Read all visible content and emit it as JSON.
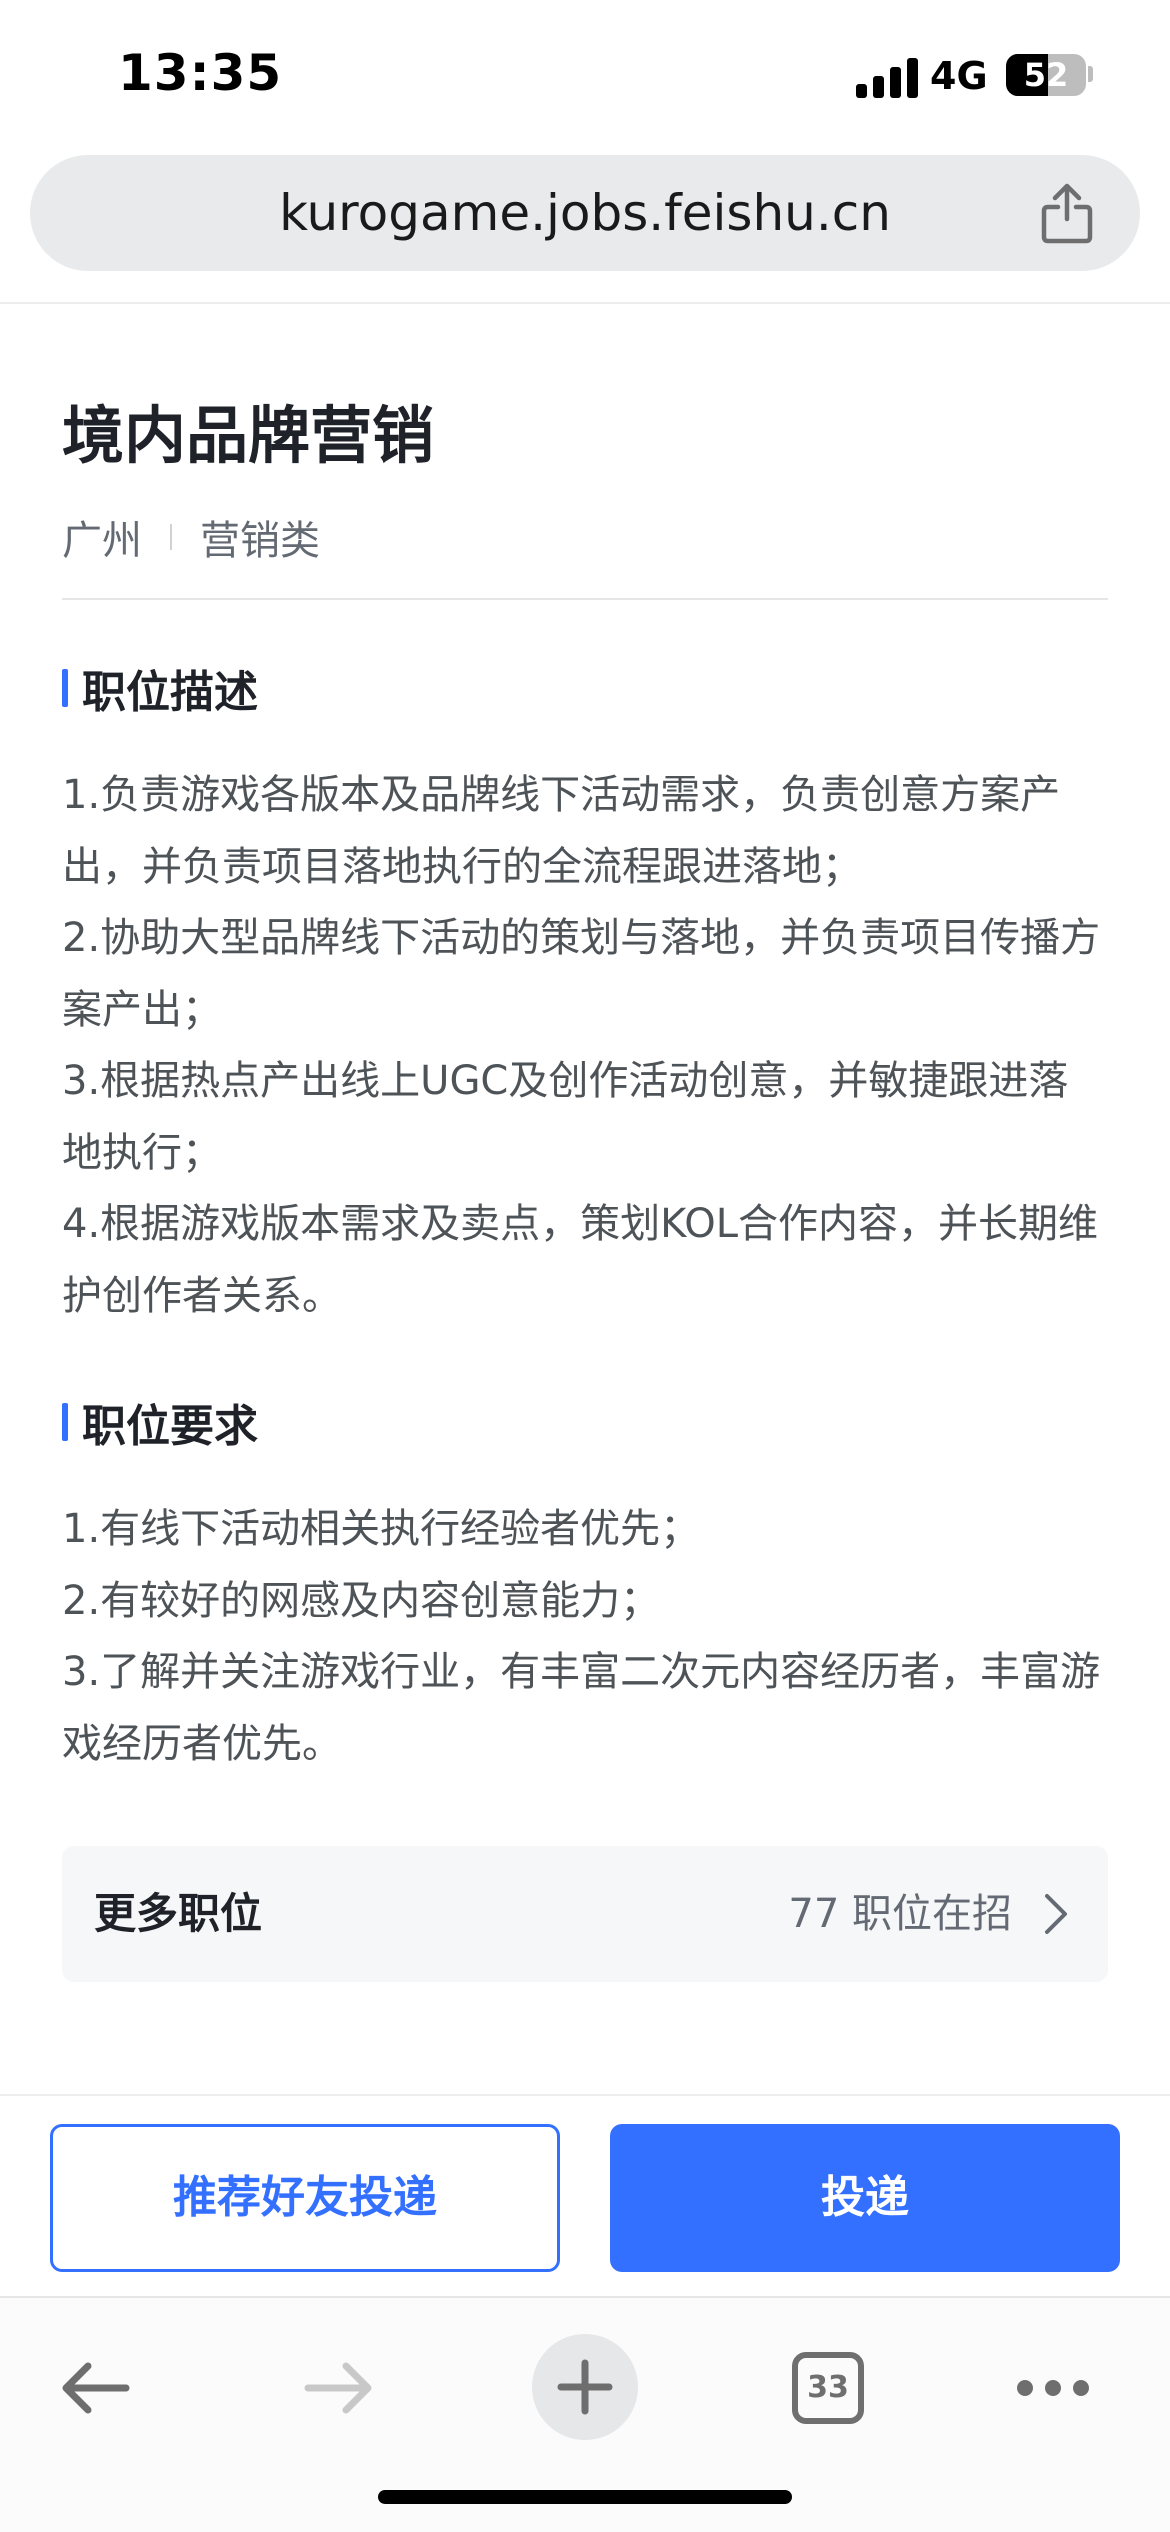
{
  "status_bar": {
    "time": "13:35",
    "network": "4G",
    "battery_level": "52",
    "battery_fraction": 0.52
  },
  "address_bar": {
    "url": "kurogame.jobs.feishu.cn",
    "share_icon": "share-icon"
  },
  "job": {
    "title": "境内品牌营销",
    "location": "广州",
    "category": "营销类"
  },
  "description": {
    "heading": "职位描述",
    "lines": [
      "1.负责游戏各版本及品牌线下活动需求，负责创意方案产出，并负责项目落地执行的全流程跟进落地；",
      "2.协助大型品牌线下活动的策划与落地，并负责项目传播方案产出；",
      "3.根据热点产出线上UGC及创作活动创意，并敏捷跟进落地执行；",
      "4.根据游戏版本需求及卖点，策划KOL合作内容，并长期维护创作者关系。"
    ]
  },
  "requirements": {
    "heading": "职位要求",
    "lines": [
      "1.有线下活动相关执行经验者优先；",
      "2.有较好的网感及内容创意能力；",
      "3.了解并关注游戏行业，有丰富二次元内容经历者，丰富游戏经历者优先。"
    ]
  },
  "more_positions": {
    "label": "更多职位",
    "count_text": "77 职位在招"
  },
  "actions": {
    "refer_label": "推荐好友投递",
    "apply_label": "投递"
  },
  "toolbar": {
    "tab_count": "33"
  },
  "colors": {
    "accent": "#3370ff",
    "text_primary": "#1f2329",
    "text_secondary": "#4e5358"
  }
}
